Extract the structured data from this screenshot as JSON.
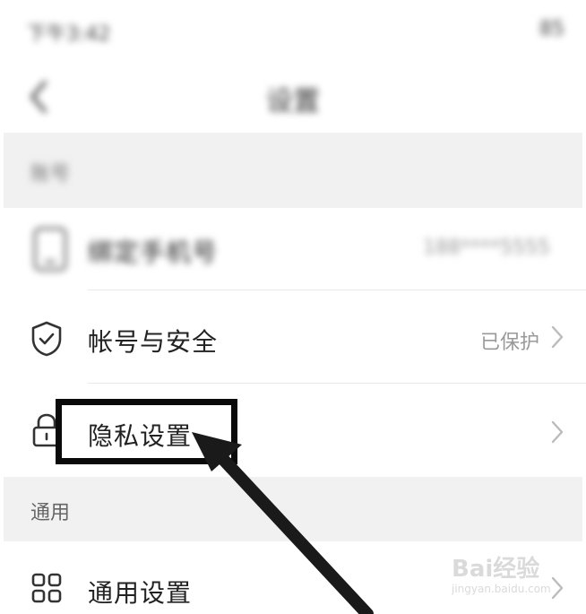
{
  "status_bar": {
    "time": "下午3:42",
    "battery": "85"
  },
  "nav": {
    "title": "设置"
  },
  "sections": [
    {
      "label": "账号"
    },
    {
      "label": "通用"
    }
  ],
  "rows": {
    "phone": {
      "title": "绑定手机号",
      "value": "188****5555"
    },
    "account": {
      "title": "帐号与安全",
      "value": "已保护",
      "icon": "shield-check-icon"
    },
    "privacy": {
      "title": "隐私设置",
      "icon": "lock-icon"
    },
    "general": {
      "title": "通用设置",
      "icon": "grid-icon"
    }
  },
  "annotation": {
    "highlight_target": "隐私设置",
    "arrow_color": "#1a1a1a"
  },
  "watermark": {
    "logo": "Bai经验",
    "sub": "jingyan.baidu.com"
  }
}
